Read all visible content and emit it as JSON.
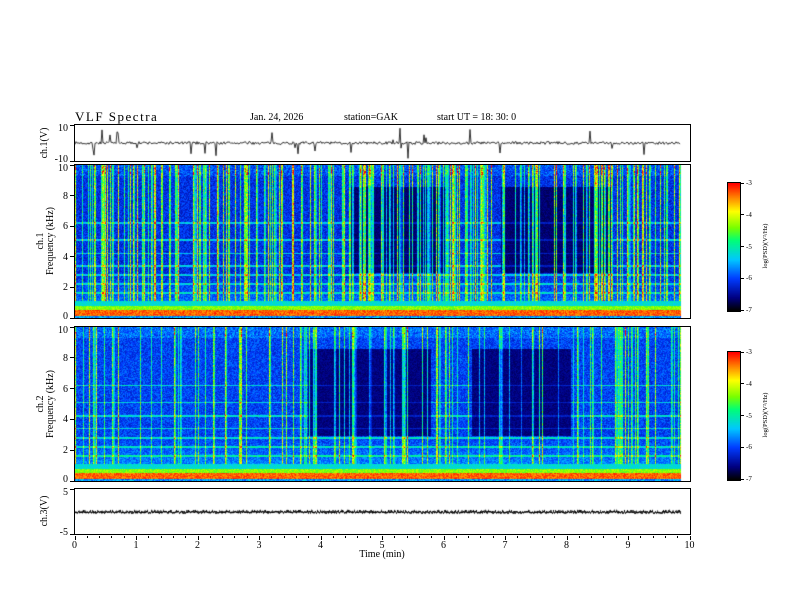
{
  "header": {
    "title": "VLF  Spectra",
    "date": "Jan. 24, 2026",
    "station": "station=GAK",
    "start_ut": "start UT =   18: 30: 0"
  },
  "xaxis": {
    "label": "Time (min)",
    "ticks": [
      "0",
      "1",
      "2",
      "3",
      "4",
      "5",
      "6",
      "7",
      "8",
      "9",
      "10"
    ],
    "range": [
      0,
      10
    ]
  },
  "colorbar": {
    "label": "log(PSD)(V²/Hz)",
    "ticks": [
      "-3",
      "-4",
      "-5",
      "-6",
      "-7"
    ],
    "range": [
      -7,
      -3
    ]
  },
  "panels": {
    "ch1_wave": {
      "ylabel": "ch.1(V)",
      "yticks": [
        "10",
        "-10"
      ],
      "yrange": [
        -10,
        10
      ]
    },
    "ch1_spec": {
      "ylabel_ch": "ch.1",
      "ylabel_freq": "Frequency (kHz)",
      "yticks": [
        "10",
        "8",
        "6",
        "4",
        "2",
        "0"
      ],
      "yrange": [
        0,
        10
      ]
    },
    "ch2_spec": {
      "ylabel_ch": "ch.2",
      "ylabel_freq": "Frequency (kHz)",
      "yticks": [
        "10",
        "8",
        "6",
        "4",
        "2",
        "0"
      ],
      "yrange": [
        0,
        10
      ]
    },
    "ch3_wave": {
      "ylabel": "ch.3(V)",
      "yticks": [
        "5",
        "-5"
      ],
      "yrange": [
        -5,
        5
      ]
    }
  },
  "chart_data": [
    {
      "type": "line",
      "name": "ch.1 time series",
      "xlabel": "Time (min)",
      "xrange": [
        0,
        10
      ],
      "ylabel": "ch.1(V)",
      "yrange": [
        -10,
        10
      ],
      "description": "broadband noise fluctuating around 0 V with frequent impulsive spikes up to about ±9 V across the full 0-10 min record"
    },
    {
      "type": "heatmap",
      "name": "ch.1 VLF spectrogram",
      "xrange": [
        0,
        10
      ],
      "xlabel": "Time (min)",
      "yrange": [
        0,
        10
      ],
      "ylabel": "Frequency (kHz)",
      "zrange": [
        -7,
        -3
      ],
      "zlabel": "log(PSD)(V²/Hz)",
      "features": {
        "strong_red_band_khz": [
          0.15,
          0.5
        ],
        "cyan_band_khz": [
          0.75,
          1.05
        ],
        "stripe_lines_khz": [
          1.6,
          2.2,
          2.8,
          3.4,
          4.2,
          5.1,
          6.2
        ],
        "vertical_sferic_streaks": "dense full-band green/yellow streaks, occasional red tips near 10 kHz",
        "background_level_logpsd": -6.5,
        "dark_patches": "black low-power patches between ~3 and 8.5 kHz"
      }
    },
    {
      "type": "heatmap",
      "name": "ch.2 VLF spectrogram",
      "xrange": [
        0,
        10
      ],
      "xlabel": "Time (min)",
      "yrange": [
        0,
        10
      ],
      "ylabel": "Frequency (kHz)",
      "zrange": [
        -7,
        -3
      ],
      "zlabel": "log(PSD)(V²/Hz)",
      "features": {
        "strong_red_band_khz": [
          0.15,
          0.5
        ],
        "cyan_band_khz": [
          0.75,
          1.05
        ],
        "stripe_lines_khz": [
          1.6,
          2.2,
          2.8,
          3.4,
          4.2,
          5.1,
          6.2
        ],
        "vertical_sferic_streaks": "sparser and weaker than ch.1, mostly green",
        "background_level_logpsd": -6.3,
        "dark_patches": "fewer, weaker dark patches"
      }
    },
    {
      "type": "line",
      "name": "ch.3 time series",
      "xlabel": "Time (min)",
      "xrange": [
        0,
        10
      ],
      "ylabel": "ch.3(V)",
      "yrange": [
        -5,
        5
      ],
      "description": "essentially flat dense dark trace at ~0 V for the whole record"
    }
  ]
}
